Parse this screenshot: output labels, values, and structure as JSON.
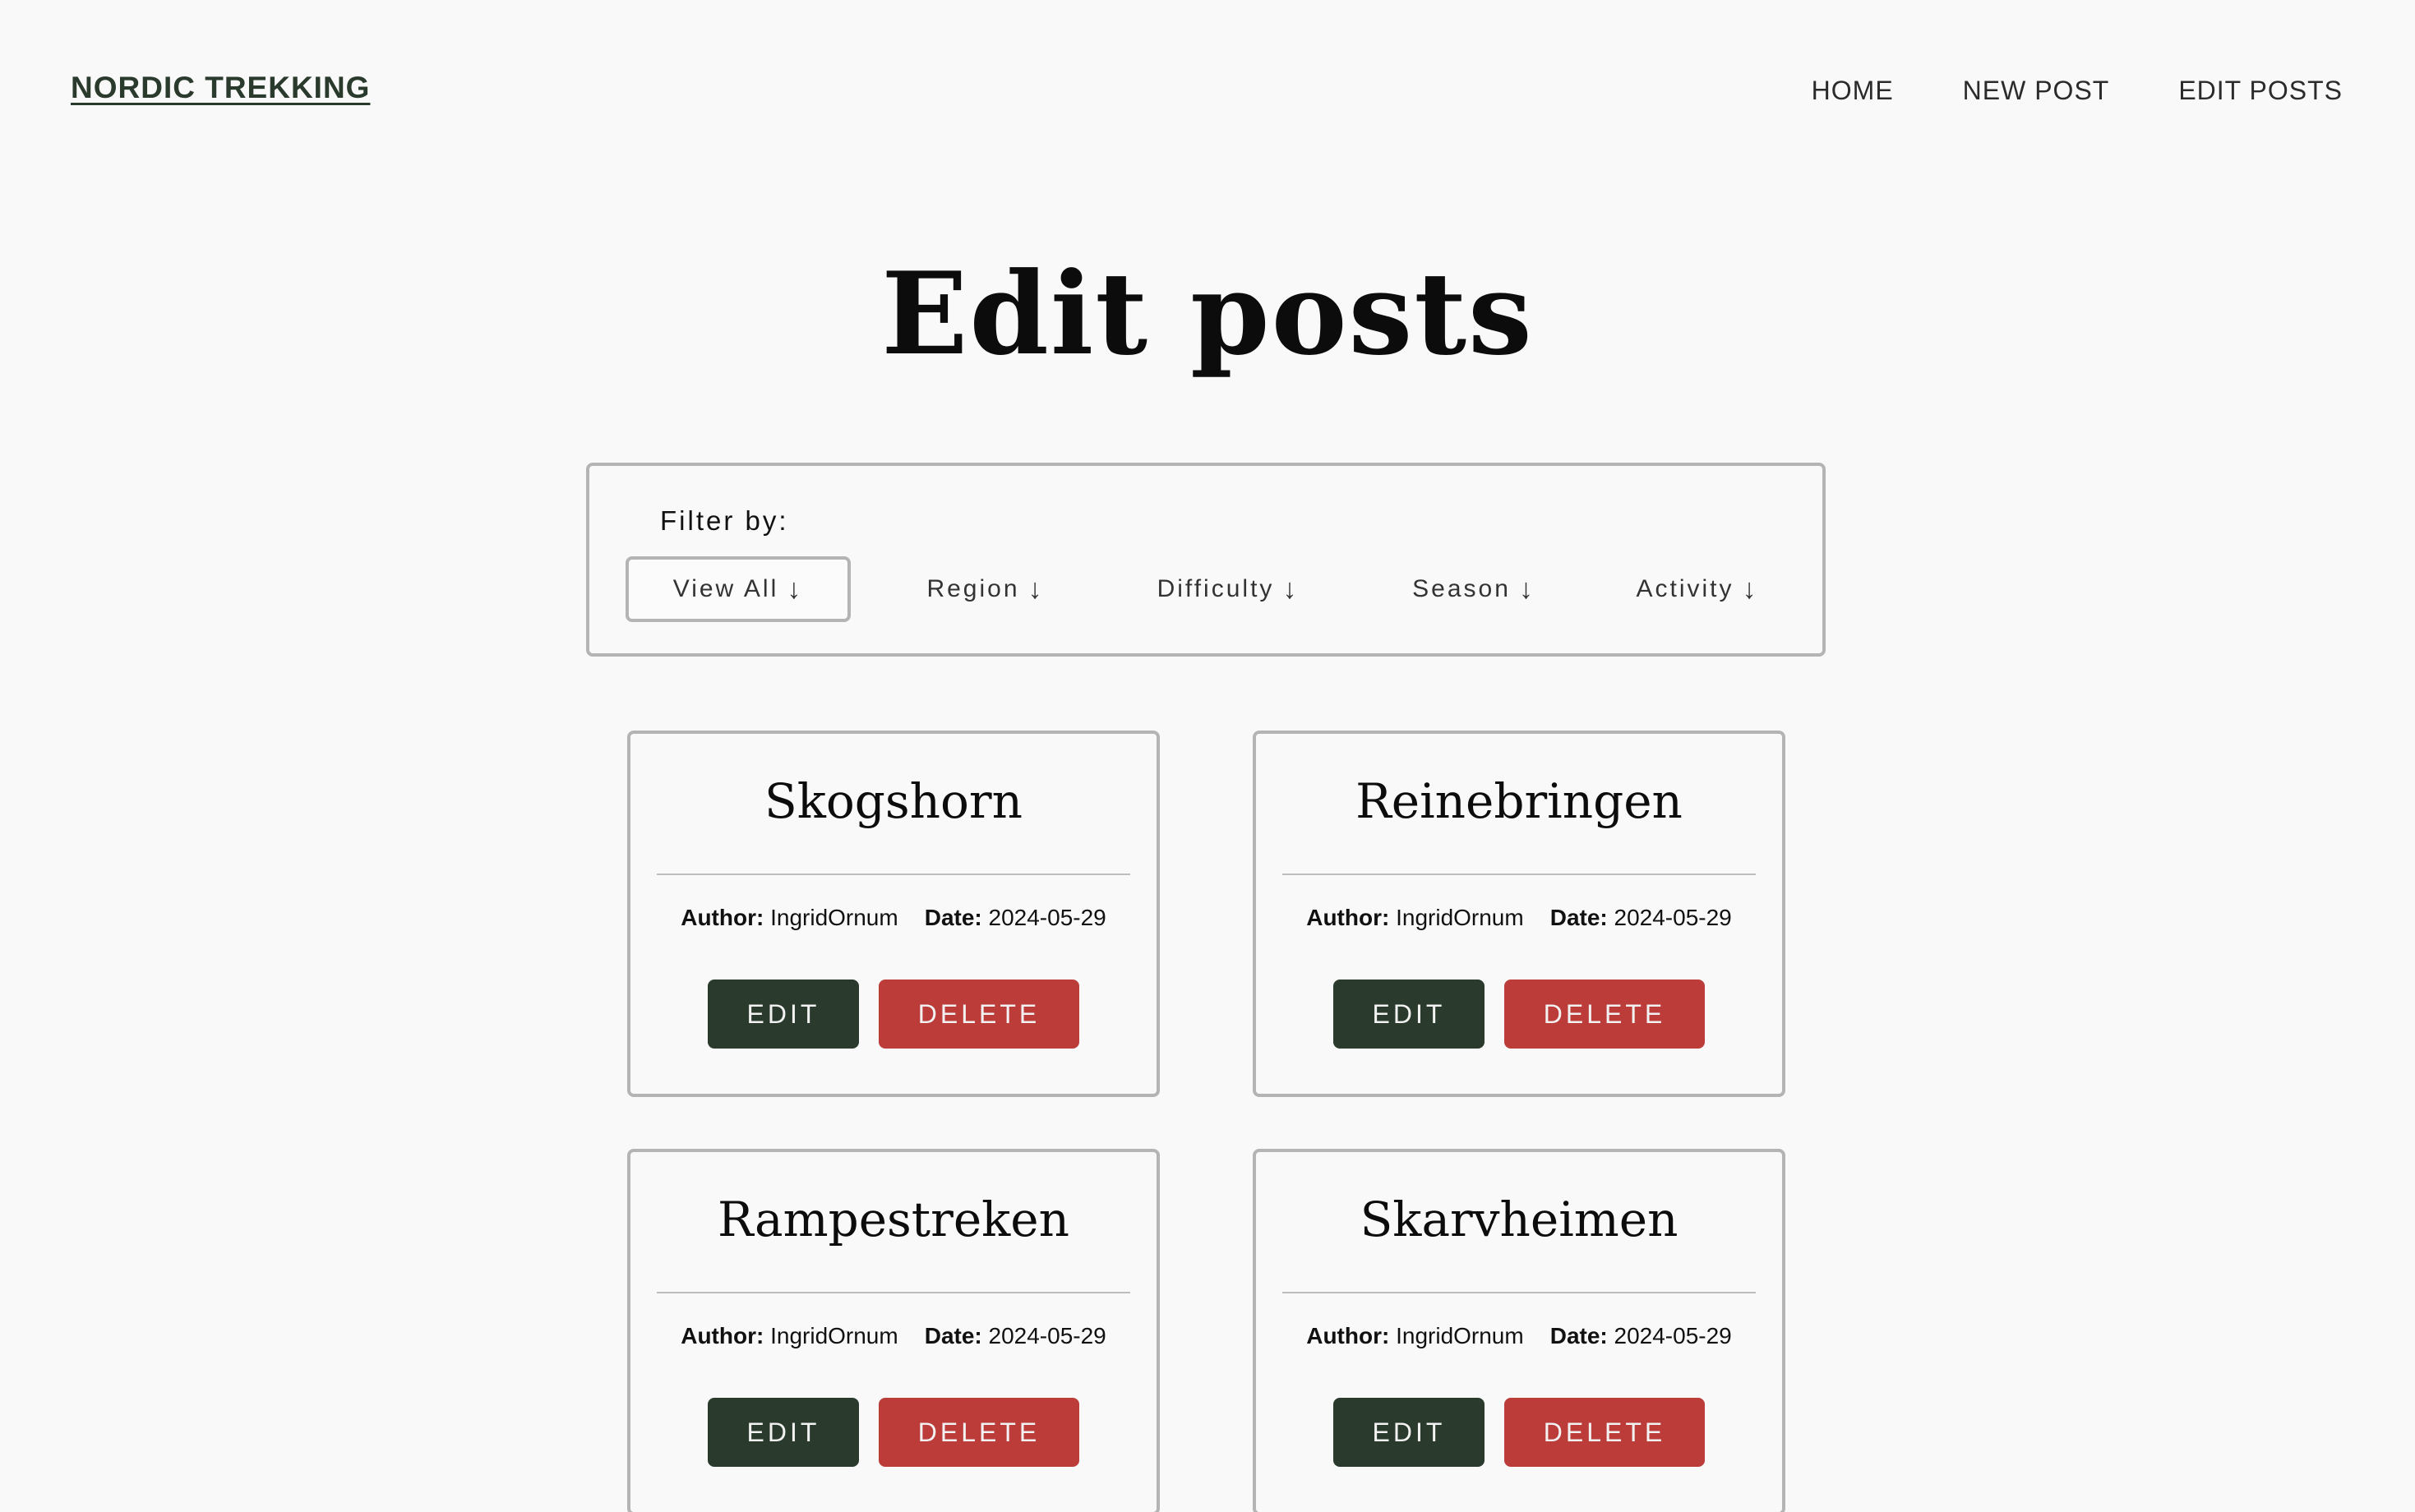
{
  "header": {
    "brand": "NORDIC TREKKING",
    "nav": [
      "HOME",
      "NEW POST",
      "EDIT POSTS"
    ]
  },
  "main": {
    "title": "Edit posts"
  },
  "filter": {
    "label": "Filter by:",
    "options": [
      {
        "label": "View All",
        "arrow": "↓",
        "active": true
      },
      {
        "label": "Region",
        "arrow": "↓",
        "active": false
      },
      {
        "label": "Difficulty",
        "arrow": "↓",
        "active": false
      },
      {
        "label": "Season",
        "arrow": "↓",
        "active": false
      },
      {
        "label": "Activity",
        "arrow": "↓",
        "active": false
      }
    ]
  },
  "posts": [
    {
      "title": "Skogshorn",
      "author_label": "Author:",
      "author": "IngridOrnum",
      "date_label": "Date:",
      "date": "2024-05-29",
      "edit_label": "EDIT",
      "delete_label": "DELETE"
    },
    {
      "title": "Reinebringen",
      "author_label": "Author:",
      "author": "IngridOrnum",
      "date_label": "Date:",
      "date": "2024-05-29",
      "edit_label": "EDIT",
      "delete_label": "DELETE"
    },
    {
      "title": "Rampestreken",
      "author_label": "Author:",
      "author": "IngridOrnum",
      "date_label": "Date:",
      "date": "2024-05-29",
      "edit_label": "EDIT",
      "delete_label": "DELETE"
    },
    {
      "title": "Skarvheimen",
      "author_label": "Author:",
      "author": "IngridOrnum",
      "date_label": "Date:",
      "date": "2024-05-29",
      "edit_label": "EDIT",
      "delete_label": "DELETE"
    }
  ],
  "colors": {
    "background": "#f9f9f9",
    "brand_green": "#2a3a2c",
    "delete_red": "#bb3c39",
    "border_gray": "#b4b4b4"
  }
}
